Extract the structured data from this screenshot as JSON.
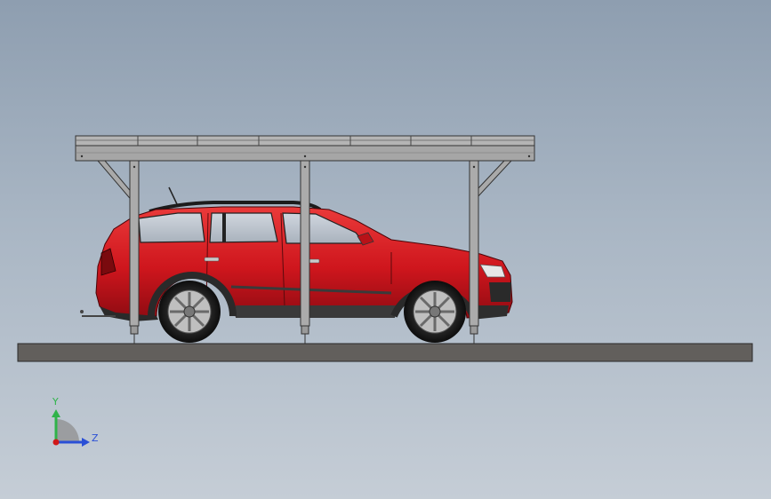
{
  "viewport": {
    "background_top": "#8e9eb0",
    "background_bottom": "#c5cdd6"
  },
  "model": {
    "carport_color": "#a8a8a8",
    "car_body_color": "#d41a20",
    "ground_slab_color": "#625f5c"
  },
  "triad": {
    "y_label": "Y",
    "z_label": "Z",
    "y_color": "#2fb34a",
    "z_color": "#2a4fd6",
    "origin_color": "#d01818"
  }
}
